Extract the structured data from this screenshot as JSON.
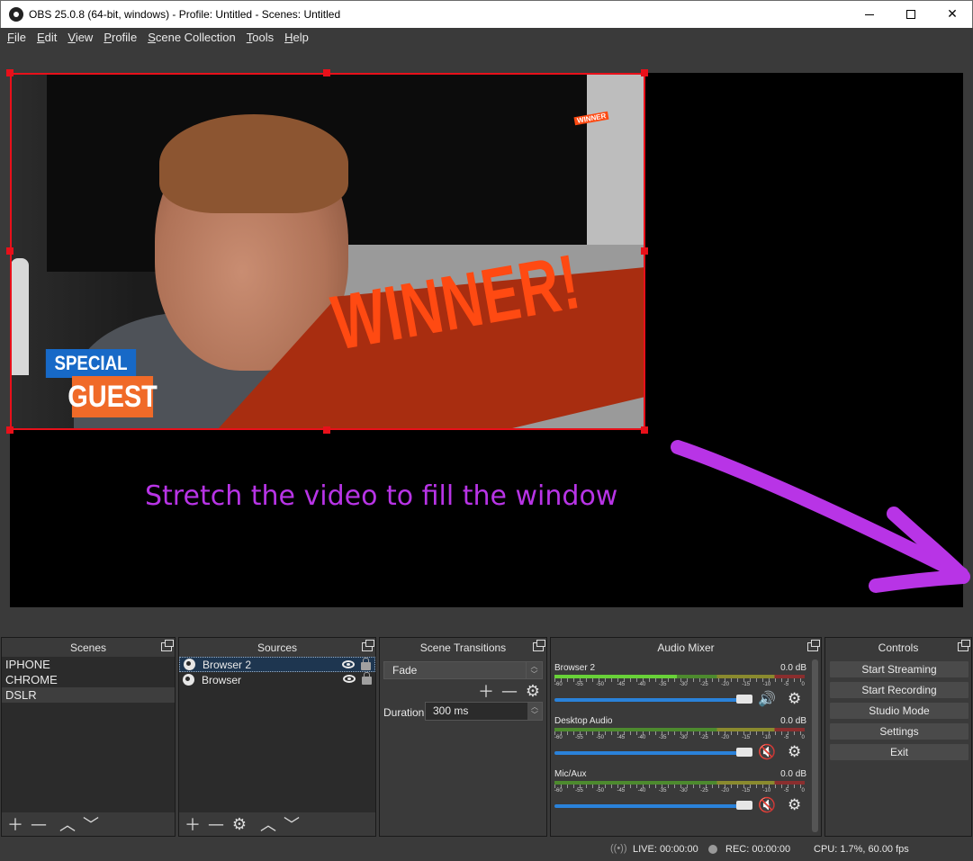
{
  "window": {
    "title": "OBS 25.0.8 (64-bit, windows) - Profile: Untitled - Scenes: Untitled"
  },
  "menu": [
    {
      "pre": "",
      "ul": "F",
      "post": "ile"
    },
    {
      "pre": "",
      "ul": "E",
      "post": "dit"
    },
    {
      "pre": "",
      "ul": "V",
      "post": "iew"
    },
    {
      "pre": "",
      "ul": "P",
      "post": "rofile"
    },
    {
      "pre": "",
      "ul": "S",
      "post": "cene Collection"
    },
    {
      "pre": "",
      "ul": "T",
      "post": "ools"
    },
    {
      "pre": "",
      "ul": "H",
      "post": "elp"
    }
  ],
  "preview": {
    "overlay_special": "SPECIAL",
    "overlay_guest": "GUEST",
    "overlay_winner": "WINNER!",
    "overlay_small_winner": "WINNER",
    "annotation": "Stretch the video to fill the window",
    "annotation_color": "#b834e6",
    "selection_color": "#e8101a"
  },
  "scenes": {
    "title": "Scenes",
    "items": [
      "IPHONE",
      "CHROME",
      "DSLR"
    ],
    "selected": "DSLR"
  },
  "sources": {
    "title": "Sources",
    "items": [
      "Browser 2",
      "Browser"
    ],
    "selected": "Browser 2"
  },
  "transitions": {
    "title": "Scene Transitions",
    "selected": "Fade",
    "duration_label": "Duration",
    "duration_value": "300 ms"
  },
  "mixer": {
    "title": "Audio Mixer",
    "scale": [
      "-60",
      "-55",
      "-50",
      "-45",
      "-40",
      "-35",
      "-30",
      "-25",
      "-20",
      "-15",
      "-10",
      "-5",
      "0"
    ],
    "channels": [
      {
        "name": "Browser 2",
        "db": "0.0 dB",
        "muted": false
      },
      {
        "name": "Desktop Audio",
        "db": "0.0 dB",
        "muted": true
      },
      {
        "name": "Mic/Aux",
        "db": "0.0 dB",
        "muted": true
      }
    ]
  },
  "controls": {
    "title": "Controls",
    "buttons": [
      "Start Streaming",
      "Start Recording",
      "Studio Mode",
      "Settings",
      "Exit"
    ]
  },
  "status": {
    "live": "LIVE: 00:00:00",
    "rec": "REC: 00:00:00",
    "cpu": "CPU: 1.7%, 60.00 fps"
  }
}
